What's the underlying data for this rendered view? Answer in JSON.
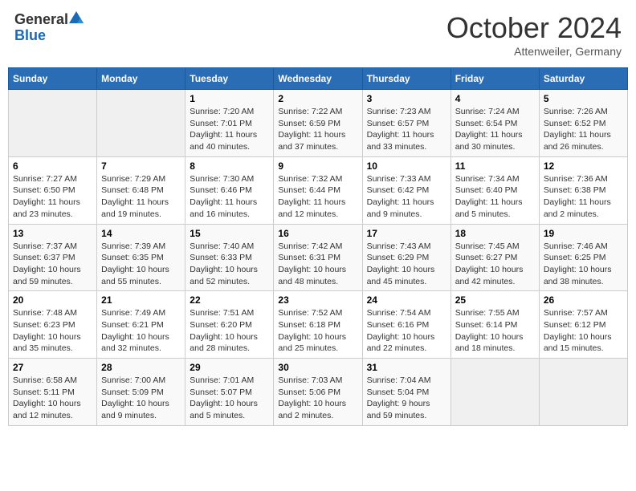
{
  "header": {
    "logo_general": "General",
    "logo_blue": "Blue",
    "month_title": "October 2024",
    "location": "Attenweiler, Germany"
  },
  "weekdays": [
    "Sunday",
    "Monday",
    "Tuesday",
    "Wednesday",
    "Thursday",
    "Friday",
    "Saturday"
  ],
  "weeks": [
    [
      {
        "day": "",
        "content": ""
      },
      {
        "day": "",
        "content": ""
      },
      {
        "day": "1",
        "content": "Sunrise: 7:20 AM\nSunset: 7:01 PM\nDaylight: 11 hours\nand 40 minutes."
      },
      {
        "day": "2",
        "content": "Sunrise: 7:22 AM\nSunset: 6:59 PM\nDaylight: 11 hours\nand 37 minutes."
      },
      {
        "day": "3",
        "content": "Sunrise: 7:23 AM\nSunset: 6:57 PM\nDaylight: 11 hours\nand 33 minutes."
      },
      {
        "day": "4",
        "content": "Sunrise: 7:24 AM\nSunset: 6:54 PM\nDaylight: 11 hours\nand 30 minutes."
      },
      {
        "day": "5",
        "content": "Sunrise: 7:26 AM\nSunset: 6:52 PM\nDaylight: 11 hours\nand 26 minutes."
      }
    ],
    [
      {
        "day": "6",
        "content": "Sunrise: 7:27 AM\nSunset: 6:50 PM\nDaylight: 11 hours\nand 23 minutes."
      },
      {
        "day": "7",
        "content": "Sunrise: 7:29 AM\nSunset: 6:48 PM\nDaylight: 11 hours\nand 19 minutes."
      },
      {
        "day": "8",
        "content": "Sunrise: 7:30 AM\nSunset: 6:46 PM\nDaylight: 11 hours\nand 16 minutes."
      },
      {
        "day": "9",
        "content": "Sunrise: 7:32 AM\nSunset: 6:44 PM\nDaylight: 11 hours\nand 12 minutes."
      },
      {
        "day": "10",
        "content": "Sunrise: 7:33 AM\nSunset: 6:42 PM\nDaylight: 11 hours\nand 9 minutes."
      },
      {
        "day": "11",
        "content": "Sunrise: 7:34 AM\nSunset: 6:40 PM\nDaylight: 11 hours\nand 5 minutes."
      },
      {
        "day": "12",
        "content": "Sunrise: 7:36 AM\nSunset: 6:38 PM\nDaylight: 11 hours\nand 2 minutes."
      }
    ],
    [
      {
        "day": "13",
        "content": "Sunrise: 7:37 AM\nSunset: 6:37 PM\nDaylight: 10 hours\nand 59 minutes."
      },
      {
        "day": "14",
        "content": "Sunrise: 7:39 AM\nSunset: 6:35 PM\nDaylight: 10 hours\nand 55 minutes."
      },
      {
        "day": "15",
        "content": "Sunrise: 7:40 AM\nSunset: 6:33 PM\nDaylight: 10 hours\nand 52 minutes."
      },
      {
        "day": "16",
        "content": "Sunrise: 7:42 AM\nSunset: 6:31 PM\nDaylight: 10 hours\nand 48 minutes."
      },
      {
        "day": "17",
        "content": "Sunrise: 7:43 AM\nSunset: 6:29 PM\nDaylight: 10 hours\nand 45 minutes."
      },
      {
        "day": "18",
        "content": "Sunrise: 7:45 AM\nSunset: 6:27 PM\nDaylight: 10 hours\nand 42 minutes."
      },
      {
        "day": "19",
        "content": "Sunrise: 7:46 AM\nSunset: 6:25 PM\nDaylight: 10 hours\nand 38 minutes."
      }
    ],
    [
      {
        "day": "20",
        "content": "Sunrise: 7:48 AM\nSunset: 6:23 PM\nDaylight: 10 hours\nand 35 minutes."
      },
      {
        "day": "21",
        "content": "Sunrise: 7:49 AM\nSunset: 6:21 PM\nDaylight: 10 hours\nand 32 minutes."
      },
      {
        "day": "22",
        "content": "Sunrise: 7:51 AM\nSunset: 6:20 PM\nDaylight: 10 hours\nand 28 minutes."
      },
      {
        "day": "23",
        "content": "Sunrise: 7:52 AM\nSunset: 6:18 PM\nDaylight: 10 hours\nand 25 minutes."
      },
      {
        "day": "24",
        "content": "Sunrise: 7:54 AM\nSunset: 6:16 PM\nDaylight: 10 hours\nand 22 minutes."
      },
      {
        "day": "25",
        "content": "Sunrise: 7:55 AM\nSunset: 6:14 PM\nDaylight: 10 hours\nand 18 minutes."
      },
      {
        "day": "26",
        "content": "Sunrise: 7:57 AM\nSunset: 6:12 PM\nDaylight: 10 hours\nand 15 minutes."
      }
    ],
    [
      {
        "day": "27",
        "content": "Sunrise: 6:58 AM\nSunset: 5:11 PM\nDaylight: 10 hours\nand 12 minutes."
      },
      {
        "day": "28",
        "content": "Sunrise: 7:00 AM\nSunset: 5:09 PM\nDaylight: 10 hours\nand 9 minutes."
      },
      {
        "day": "29",
        "content": "Sunrise: 7:01 AM\nSunset: 5:07 PM\nDaylight: 10 hours\nand 5 minutes."
      },
      {
        "day": "30",
        "content": "Sunrise: 7:03 AM\nSunset: 5:06 PM\nDaylight: 10 hours\nand 2 minutes."
      },
      {
        "day": "31",
        "content": "Sunrise: 7:04 AM\nSunset: 5:04 PM\nDaylight: 9 hours\nand 59 minutes."
      },
      {
        "day": "",
        "content": ""
      },
      {
        "day": "",
        "content": ""
      }
    ]
  ]
}
